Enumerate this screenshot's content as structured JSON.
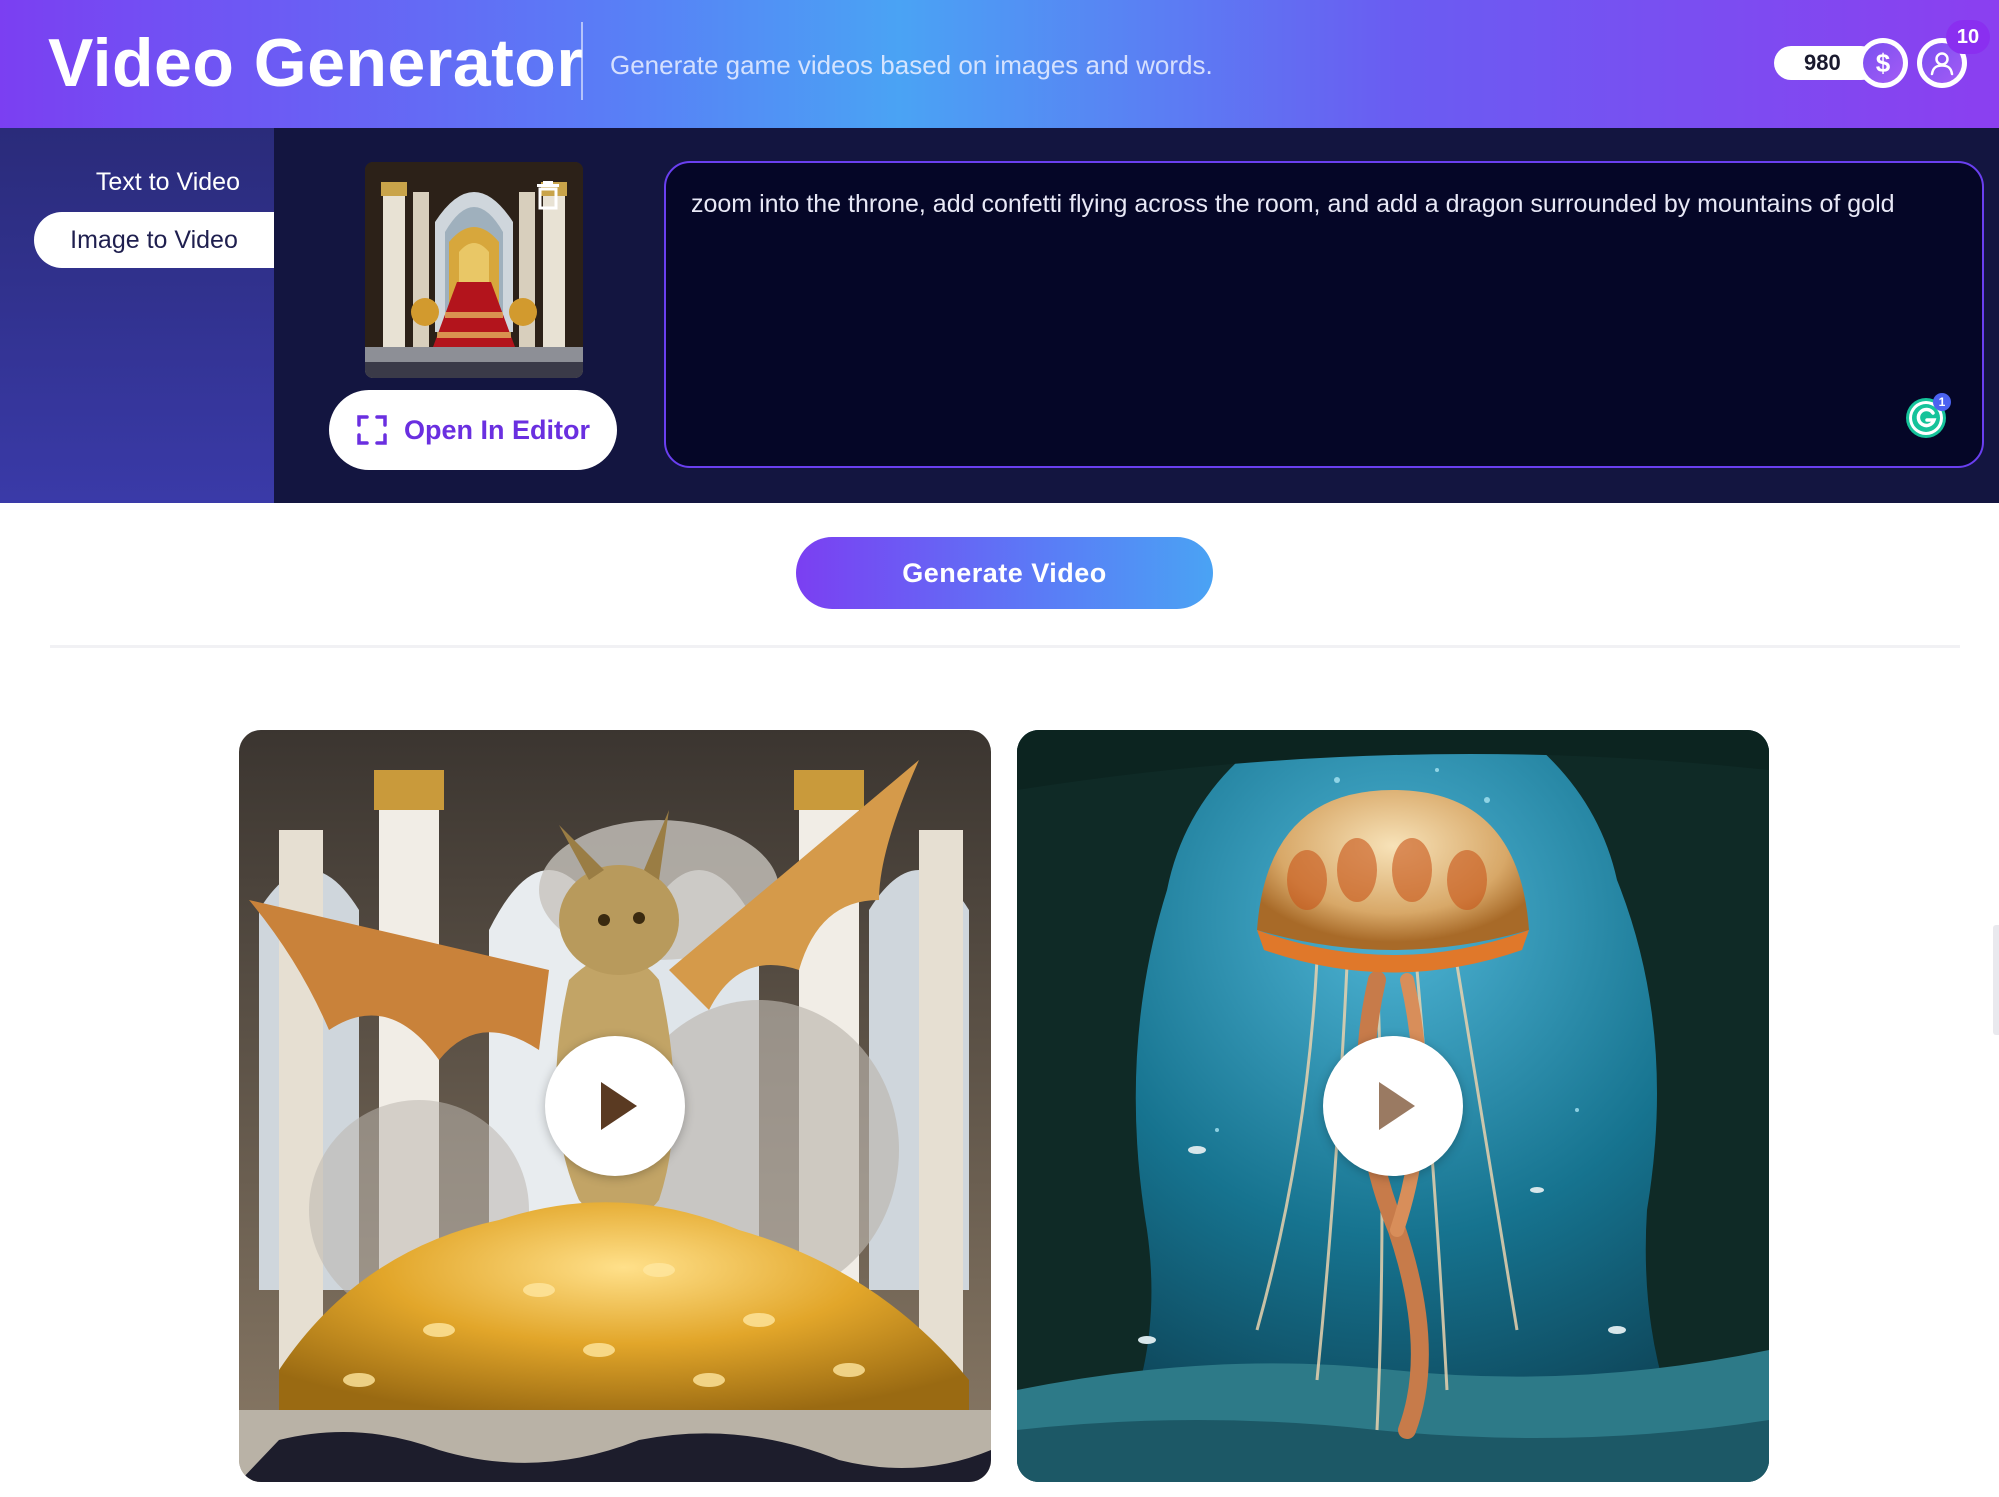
{
  "header": {
    "title": "Video Generator",
    "subtitle": "Generate game videos based on images and words.",
    "credits": "980",
    "coin_symbol": "$",
    "notification_count": "10"
  },
  "modes": {
    "items": [
      {
        "label": "Text to Video",
        "active": false
      },
      {
        "label": "Image to Video",
        "active": true
      }
    ]
  },
  "image_input": {
    "open_editor_label": "Open In Editor"
  },
  "prompt": {
    "value": "zoom into the throne, add confetti flying across the room, and add a dragon surrounded by mountains of gold",
    "grammarly_count": "1"
  },
  "actions": {
    "generate_label": "Generate Video"
  },
  "videos": [
    {
      "subject": "dragon on pile of gold coins in throne hall",
      "icon": "play-icon"
    },
    {
      "subject": "jellyfish in underwater cave",
      "icon": "play-icon"
    }
  ],
  "colors": {
    "brand_purple": "#7b3ff2",
    "brand_blue": "#4aa3f4",
    "panel_navy": "#131540",
    "prompt_bg": "#050627"
  }
}
